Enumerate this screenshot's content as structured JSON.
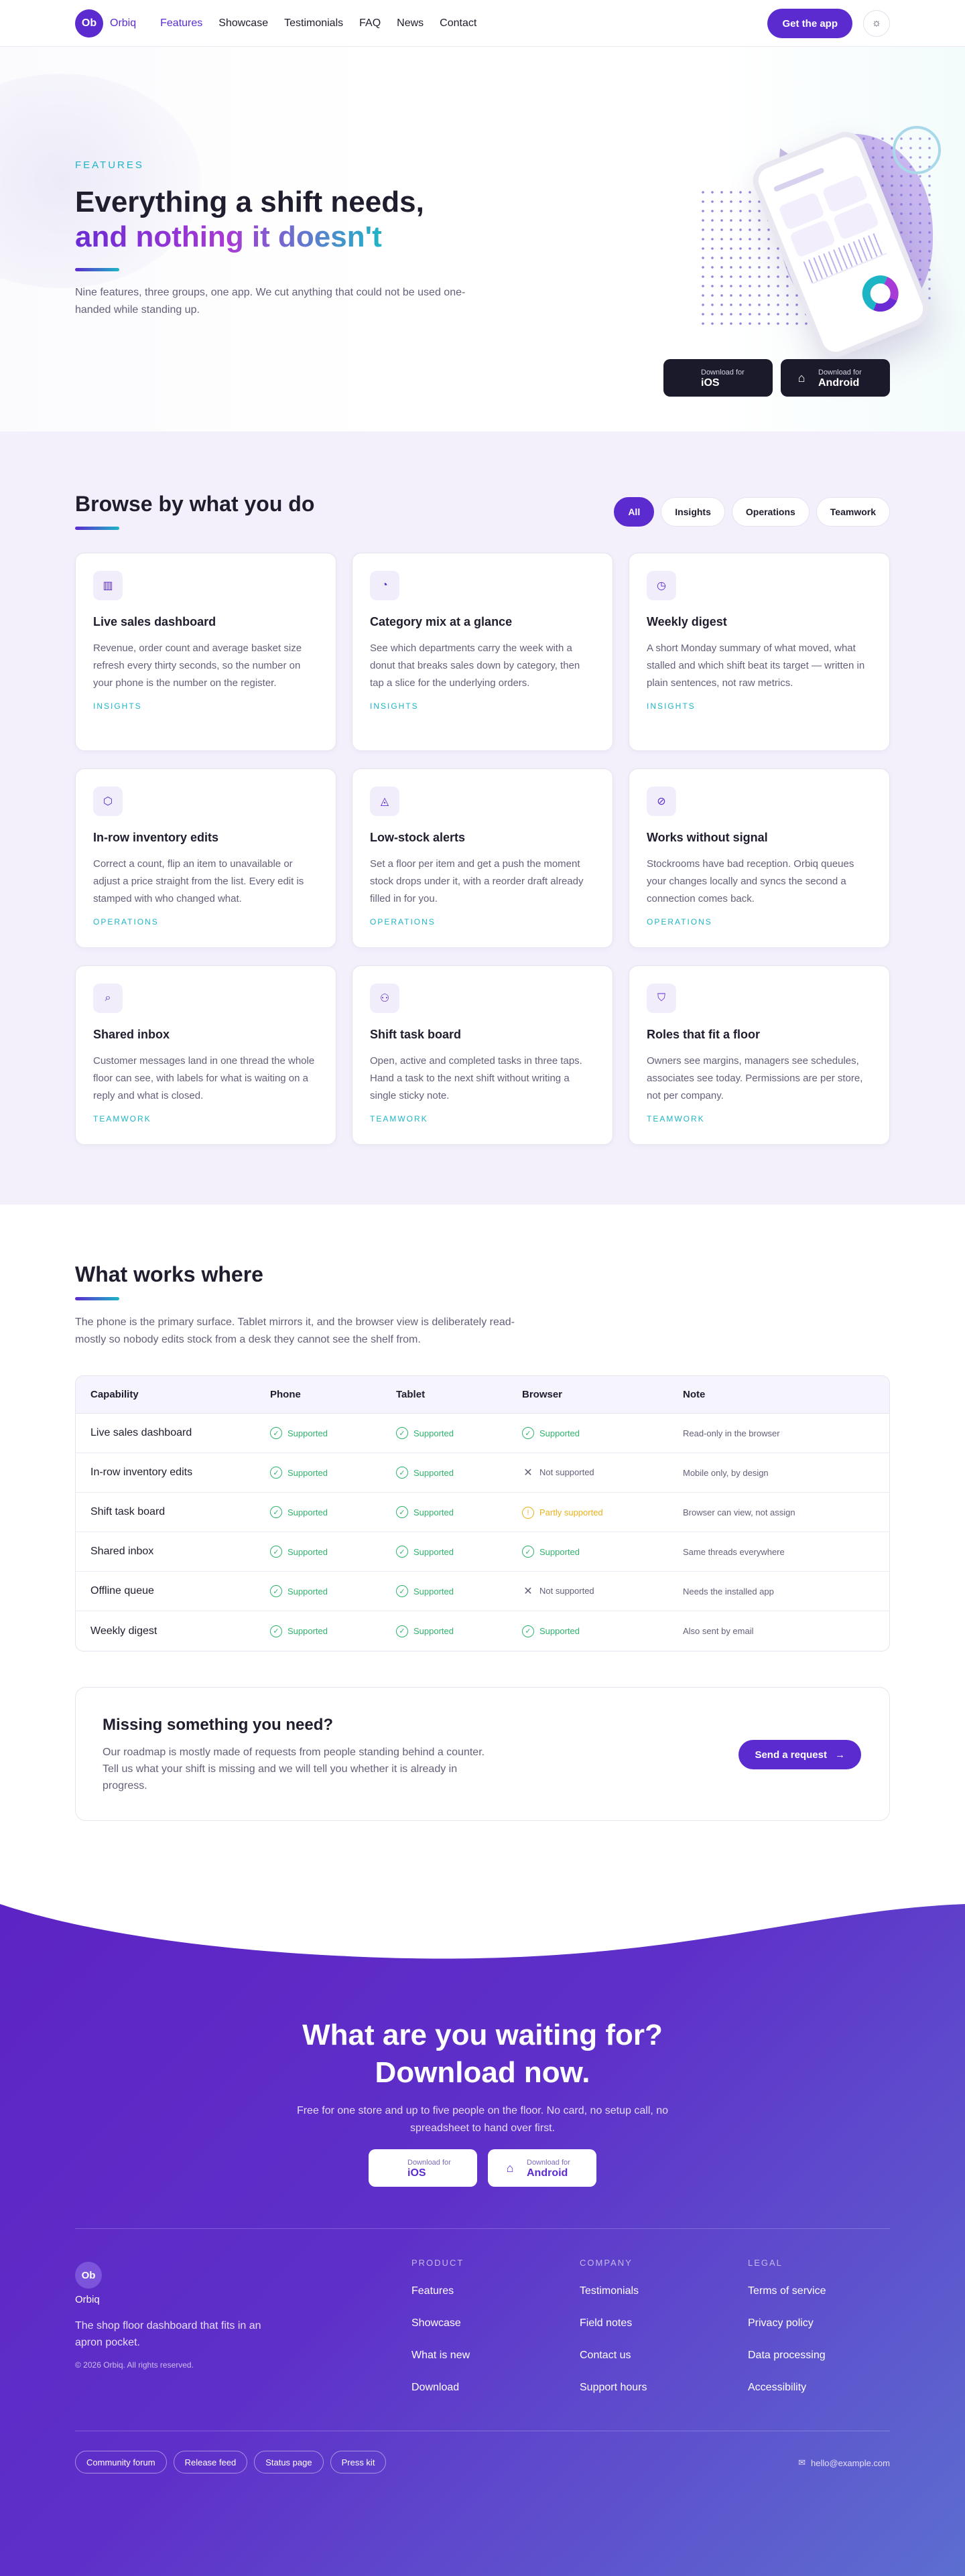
{
  "nav": {
    "logo_badge": "Ob",
    "logo_text": "Orbiq",
    "links": [
      "Features",
      "Showcase",
      "Testimonials",
      "FAQ",
      "News",
      "Contact"
    ],
    "active": "Features",
    "cta": "Get the app",
    "theme_icon": "sun-icon"
  },
  "hero": {
    "eyebrow": "FEATURES",
    "title_line1": "Everything a shift needs,",
    "title_line2": "and nothing it doesn't",
    "subtitle": "Nine features, three groups, one app. We cut anything that could not be used one-handed while standing up.",
    "ios": {
      "small": "Download for",
      "big": "iOS"
    },
    "android": {
      "small": "Download for",
      "big": "Android"
    }
  },
  "features": {
    "title": "Browse by what you do",
    "filters": [
      "All",
      "Insights",
      "Operations",
      "Teamwork"
    ],
    "active_filter": "All",
    "cards": [
      {
        "icon": "bar-chart-icon",
        "glyph": "▥",
        "title": "Live sales dashboard",
        "desc": "Revenue, order count and average basket size refresh every thirty seconds, so the number on your phone is the number on the register.",
        "tag": "INSIGHTS"
      },
      {
        "icon": "pie-icon",
        "glyph": "◔",
        "title": "Category mix at a glance",
        "desc": "See which departments carry the week with a donut that breaks sales down by category, then tap a slice for the underlying orders.",
        "tag": "INSIGHTS"
      },
      {
        "icon": "clock-icon",
        "glyph": "◷",
        "title": "Weekly digest",
        "desc": "A short Monday summary of what moved, what stalled and which shift beat its target — written in plain sentences, not raw metrics.",
        "tag": "INSIGHTS"
      },
      {
        "icon": "box-icon",
        "glyph": "⬡",
        "title": "In-row inventory edits",
        "desc": "Correct a count, flip an item to unavailable or adjust a price straight from the list. Every edit is stamped with who changed what.",
        "tag": "OPERATIONS"
      },
      {
        "icon": "bell-icon",
        "glyph": "◬",
        "title": "Low-stock alerts",
        "desc": "Set a floor per item and get a push the moment stock drops under it, with a reorder draft already filled in for you.",
        "tag": "OPERATIONS"
      },
      {
        "icon": "wifi-off-icon",
        "glyph": "⊘",
        "title": "Works without signal",
        "desc": "Stockrooms have bad reception. Orbiq queues your changes locally and syncs the second a connection comes back.",
        "tag": "OPERATIONS"
      },
      {
        "icon": "search-icon",
        "glyph": "⌕",
        "title": "Shared inbox",
        "desc": "Customer messages land in one thread the whole floor can see, with labels for what is waiting on a reply and what is closed.",
        "tag": "TEAMWORK"
      },
      {
        "icon": "users-icon",
        "glyph": "⚇",
        "title": "Shift task board",
        "desc": "Open, active and completed tasks in three taps. Hand a task to the next shift without writing a single sticky note.",
        "tag": "TEAMWORK"
      },
      {
        "icon": "shield-icon",
        "glyph": "⛉",
        "title": "Roles that fit a floor",
        "desc": "Owners see margins, managers see schedules, associates see today. Permissions are per store, not per company.",
        "tag": "TEAMWORK"
      }
    ]
  },
  "matrix": {
    "title": "What works where",
    "subtitle": "The phone is the primary surface. Tablet mirrors it, and the browser view is deliberately read-mostly so nobody edits stock from a desk they cannot see the shelf from.",
    "headers": [
      "Capability",
      "Phone",
      "Tablet",
      "Browser",
      "Note"
    ],
    "rows": [
      {
        "cap": "Live sales dashboard",
        "phone": "Supported",
        "tablet": "Supported",
        "browser": "Supported",
        "browser_kind": "ok",
        "note": "Read-only in the browser"
      },
      {
        "cap": "In-row inventory edits",
        "phone": "Supported",
        "tablet": "Supported",
        "browser": "Not supported",
        "browser_kind": "no",
        "note": "Mobile only, by design"
      },
      {
        "cap": "Shift task board",
        "phone": "Supported",
        "tablet": "Supported",
        "browser": "Partly supported",
        "browser_kind": "part",
        "note": "Browser can view, not assign"
      },
      {
        "cap": "Shared inbox",
        "phone": "Supported",
        "tablet": "Supported",
        "browser": "Supported",
        "browser_kind": "ok",
        "note": "Same threads everywhere"
      },
      {
        "cap": "Offline queue",
        "phone": "Supported",
        "tablet": "Supported",
        "browser": "Not supported",
        "browser_kind": "no",
        "note": "Needs the installed app"
      },
      {
        "cap": "Weekly digest",
        "phone": "Supported",
        "tablet": "Supported",
        "browser": "Supported",
        "browser_kind": "ok",
        "note": "Also sent by email"
      }
    ]
  },
  "request": {
    "title": "Missing something you need?",
    "desc": "Our roadmap is mostly made of requests from people standing behind a counter. Tell us what your shift is missing and we will tell you whether it is already in progress.",
    "button": "Send a request"
  },
  "cta": {
    "title_line1": "What are you waiting for?",
    "title_line2": "Download now.",
    "subtitle": "Free for one store and up to five people on the floor. No card, no setup call, no spreadsheet to hand over first.",
    "ios": {
      "small": "Download for",
      "big": "iOS"
    },
    "android": {
      "small": "Download for",
      "big": "Android"
    }
  },
  "footer": {
    "badge": "Ob",
    "name": "Orbiq",
    "tagline": "The shop floor dashboard that fits in an apron pocket.",
    "copyright": "© 2026 Orbiq. All rights reserved.",
    "columns": [
      {
        "title": "PRODUCT",
        "links": [
          "Features",
          "Showcase",
          "What is new",
          "Download"
        ]
      },
      {
        "title": "COMPANY",
        "links": [
          "Testimonials",
          "Field notes",
          "Contact us",
          "Support hours"
        ]
      },
      {
        "title": "LEGAL",
        "links": [
          "Terms of service",
          "Privacy policy",
          "Data processing",
          "Accessibility"
        ]
      }
    ],
    "pills": [
      "Community forum",
      "Release feed",
      "Status page",
      "Press kit"
    ],
    "email": "hello@example.com"
  },
  "colors": {
    "brand": "#5b2bd0",
    "accent": "#1db5c6",
    "ok": "#2fb36c",
    "partial": "#e8b21d",
    "footer_bg": "#5c24c4"
  }
}
